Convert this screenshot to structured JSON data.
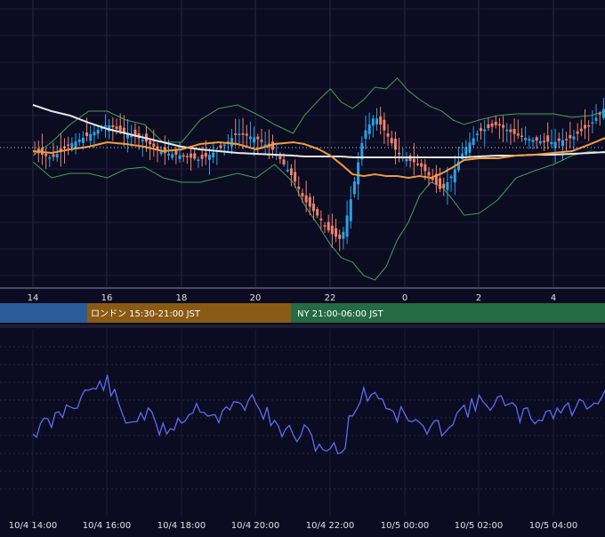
{
  "colors": {
    "background": "#0b0b22",
    "grid": "#2a2a48",
    "up_candle": "#29a3e6",
    "down_candle": "#f0826a",
    "bollinger": "#3fa34d",
    "moving_average_short": "#f39c3c",
    "moving_average_long": "#e8e8e8",
    "oscillator": "#5a6ff0",
    "session_tokyo": "#2a5c9a",
    "session_london": "#8a5a14",
    "session_ny": "#246b43",
    "axis_text": "#e0e0e0"
  },
  "top_axis": {
    "ticks": [
      "14",
      "16",
      "18",
      "20",
      "22",
      "0",
      "2",
      "4"
    ]
  },
  "sessions": [
    {
      "label": ""
    },
    {
      "label": "ロンドン 15:30-21:00 JST"
    },
    {
      "label": "NY 21:00-06:00 JST"
    }
  ],
  "bottom_axis": {
    "ticks": [
      "10/4 14:00",
      "10/4 16:00",
      "10/4 18:00",
      "10/4 20:00",
      "10/4 22:00",
      "10/5 00:00",
      "10/5 02:00",
      "10/5 04:00"
    ]
  },
  "chart_data": [
    {
      "type": "candlestick",
      "x_axis": [
        "14",
        "16",
        "18",
        "20",
        "22",
        "0",
        "2",
        "4"
      ],
      "price_path": [
        [
          13.0,
          170
        ],
        [
          13.5,
          178
        ],
        [
          14.0,
          162
        ],
        [
          14.5,
          152
        ],
        [
          15.0,
          140
        ],
        [
          15.5,
          150
        ],
        [
          16.0,
          158
        ],
        [
          16.5,
          172
        ],
        [
          17.0,
          175
        ],
        [
          17.5,
          180
        ],
        [
          18.0,
          168
        ],
        [
          18.5,
          150
        ],
        [
          19.0,
          155
        ],
        [
          19.5,
          170
        ],
        [
          20.0,
          200
        ],
        [
          20.3,
          225
        ],
        [
          20.7,
          245
        ],
        [
          21.0,
          262
        ],
        [
          21.3,
          270
        ],
        [
          21.6,
          215
        ],
        [
          21.9,
          150
        ],
        [
          22.2,
          130
        ],
        [
          22.5,
          150
        ],
        [
          22.8,
          172
        ],
        [
          23.1,
          180
        ],
        [
          23.4,
          185
        ],
        [
          23.7,
          200
        ],
        [
          24.0,
          215
        ],
        [
          24.3,
          195
        ],
        [
          24.6,
          168
        ],
        [
          25.0,
          148
        ],
        [
          25.5,
          140
        ],
        [
          26.0,
          152
        ],
        [
          26.5,
          158
        ],
        [
          27.0,
          160
        ],
        [
          27.5,
          155
        ],
        [
          28.0,
          140
        ],
        [
          28.4,
          120
        ],
        [
          28.7,
          90
        ],
        [
          29.0,
          62
        ],
        [
          29.2,
          55
        ]
      ],
      "overlays": {
        "bollinger_upper": [
          [
            13.0,
            175
          ],
          [
            13.5,
            160
          ],
          [
            14.0,
            140
          ],
          [
            14.5,
            125
          ],
          [
            15.0,
            125
          ],
          [
            15.5,
            135
          ],
          [
            16.0,
            140
          ],
          [
            16.5,
            160
          ],
          [
            17.0,
            160
          ],
          [
            17.5,
            135
          ],
          [
            18.0,
            122
          ],
          [
            18.5,
            118
          ],
          [
            19.0,
            128
          ],
          [
            19.5,
            140
          ],
          [
            20.0,
            150
          ],
          [
            20.3,
            130
          ],
          [
            20.7,
            112
          ],
          [
            21.0,
            100
          ],
          [
            21.3,
            115
          ],
          [
            21.6,
            122
          ],
          [
            21.9,
            112
          ],
          [
            22.2,
            98
          ],
          [
            22.5,
            100
          ],
          [
            22.8,
            88
          ],
          [
            23.1,
            102
          ],
          [
            23.4,
            112
          ],
          [
            23.7,
            120
          ],
          [
            24.0,
            125
          ],
          [
            24.3,
            135
          ],
          [
            24.6,
            140
          ],
          [
            25.0,
            135
          ],
          [
            25.5,
            130
          ],
          [
            26.0,
            128
          ],
          [
            26.5,
            128
          ],
          [
            27.0,
            128
          ],
          [
            27.5,
            132
          ],
          [
            28.0,
            130
          ],
          [
            28.4,
            125
          ],
          [
            28.7,
            110
          ],
          [
            29.0,
            75
          ],
          [
            29.2,
            55
          ]
        ],
        "bollinger_lower": [
          [
            13.0,
            182
          ],
          [
            13.5,
            200
          ],
          [
            14.0,
            195
          ],
          [
            14.5,
            195
          ],
          [
            15.0,
            200
          ],
          [
            15.5,
            190
          ],
          [
            16.0,
            188
          ],
          [
            16.5,
            200
          ],
          [
            17.0,
            205
          ],
          [
            17.5,
            205
          ],
          [
            18.0,
            200
          ],
          [
            18.5,
            195
          ],
          [
            19.0,
            200
          ],
          [
            19.5,
            185
          ],
          [
            20.0,
            205
          ],
          [
            20.3,
            230
          ],
          [
            20.7,
            255
          ],
          [
            21.0,
            275
          ],
          [
            21.3,
            290
          ],
          [
            21.6,
            295
          ],
          [
            21.9,
            310
          ],
          [
            22.2,
            315
          ],
          [
            22.5,
            300
          ],
          [
            22.8,
            270
          ],
          [
            23.1,
            250
          ],
          [
            23.4,
            220
          ],
          [
            23.7,
            205
          ],
          [
            24.0,
            210
          ],
          [
            24.3,
            225
          ],
          [
            24.6,
            242
          ],
          [
            25.0,
            240
          ],
          [
            25.5,
            225
          ],
          [
            26.0,
            200
          ],
          [
            26.5,
            192
          ],
          [
            27.0,
            185
          ],
          [
            27.5,
            175
          ],
          [
            28.0,
            170
          ],
          [
            28.4,
            172
          ],
          [
            28.7,
            165
          ],
          [
            29.0,
            175
          ],
          [
            29.2,
            178
          ]
        ],
        "moving_average_short": [
          [
            13.0,
            170
          ],
          [
            13.5,
            172
          ],
          [
            14.0,
            168
          ],
          [
            14.5,
            165
          ],
          [
            15.0,
            160
          ],
          [
            15.5,
            162
          ],
          [
            16.0,
            165
          ],
          [
            16.5,
            170
          ],
          [
            17.0,
            168
          ],
          [
            17.5,
            162
          ],
          [
            18.0,
            160
          ],
          [
            18.5,
            162
          ],
          [
            19.0,
            168
          ],
          [
            19.5,
            162
          ],
          [
            20.0,
            160
          ],
          [
            20.3,
            162
          ],
          [
            20.7,
            168
          ],
          [
            21.0,
            175
          ],
          [
            21.3,
            185
          ],
          [
            21.6,
            196
          ],
          [
            21.9,
            198
          ],
          [
            22.2,
            196
          ],
          [
            22.5,
            198
          ],
          [
            22.8,
            198
          ],
          [
            23.1,
            200
          ],
          [
            23.4,
            198
          ],
          [
            23.7,
            200
          ],
          [
            24.0,
            195
          ],
          [
            24.3,
            188
          ],
          [
            24.6,
            180
          ],
          [
            25.0,
            178
          ],
          [
            25.5,
            178
          ],
          [
            26.0,
            175
          ],
          [
            26.5,
            174
          ],
          [
            27.0,
            172
          ],
          [
            27.5,
            170
          ],
          [
            28.0,
            162
          ],
          [
            28.4,
            155
          ],
          [
            28.7,
            150
          ],
          [
            29.0,
            140
          ],
          [
            29.2,
            130
          ]
        ],
        "moving_average_long": [
          [
            13.0,
            118
          ],
          [
            13.5,
            125
          ],
          [
            14.0,
            130
          ],
          [
            14.5,
            138
          ],
          [
            15.0,
            145
          ],
          [
            15.5,
            150
          ],
          [
            16.0,
            155
          ],
          [
            16.5,
            160
          ],
          [
            17.0,
            165
          ],
          [
            17.5,
            168
          ],
          [
            18.0,
            170
          ],
          [
            18.5,
            172
          ],
          [
            19.0,
            173
          ],
          [
            19.5,
            174
          ],
          [
            20.0,
            175
          ],
          [
            20.3,
            176
          ],
          [
            20.7,
            176
          ],
          [
            21.0,
            176
          ],
          [
            21.3,
            176
          ],
          [
            21.6,
            177
          ],
          [
            21.9,
            177
          ],
          [
            22.2,
            177
          ],
          [
            22.5,
            177
          ],
          [
            22.8,
            177
          ],
          [
            23.1,
            177
          ],
          [
            23.4,
            177
          ],
          [
            23.7,
            177
          ],
          [
            24.0,
            177
          ],
          [
            24.3,
            177
          ],
          [
            24.6,
            177
          ],
          [
            25.0,
            176
          ],
          [
            25.5,
            175
          ],
          [
            26.0,
            175
          ],
          [
            26.5,
            174
          ],
          [
            27.0,
            174
          ],
          [
            27.5,
            173
          ],
          [
            28.0,
            172
          ],
          [
            28.4,
            171
          ],
          [
            28.7,
            169
          ],
          [
            29.0,
            167
          ],
          [
            29.2,
            165
          ]
        ]
      },
      "grid": true
    },
    {
      "type": "line",
      "x_axis": [
        "10/4 14:00",
        "10/4 16:00",
        "10/4 18:00",
        "10/4 20:00",
        "10/4 22:00",
        "10/5 00:00",
        "10/5 02:00",
        "10/5 04:00"
      ],
      "series": [
        {
          "values": [
            [
              13.0,
              485
            ],
            [
              13.5,
              475
            ],
            [
              14.0,
              455
            ],
            [
              14.5,
              440
            ],
            [
              15.0,
              430
            ],
            [
              15.5,
              475
            ],
            [
              16.0,
              465
            ],
            [
              16.5,
              485
            ],
            [
              17.0,
              470
            ],
            [
              17.5,
              455
            ],
            [
              18.0,
              470
            ],
            [
              18.5,
              455
            ],
            [
              19.0,
              450
            ],
            [
              19.5,
              480
            ],
            [
              20.0,
              490
            ],
            [
              20.3,
              488
            ],
            [
              20.7,
              500
            ],
            [
              21.0,
              505
            ],
            [
              21.3,
              510
            ],
            [
              21.6,
              460
            ],
            [
              21.9,
              445
            ],
            [
              22.2,
              440
            ],
            [
              22.5,
              455
            ],
            [
              22.8,
              465
            ],
            [
              23.1,
              470
            ],
            [
              23.4,
              480
            ],
            [
              23.7,
              485
            ],
            [
              24.0,
              480
            ],
            [
              24.3,
              470
            ],
            [
              24.6,
              460
            ],
            [
              25.0,
              455
            ],
            [
              25.5,
              450
            ],
            [
              26.0,
              465
            ],
            [
              26.5,
              470
            ],
            [
              27.0,
              462
            ],
            [
              27.5,
              460
            ],
            [
              28.0,
              450
            ],
            [
              28.4,
              445
            ],
            [
              28.7,
              430
            ],
            [
              29.0,
              422
            ],
            [
              29.2,
              440
            ]
          ]
        }
      ],
      "grid": true
    }
  ]
}
